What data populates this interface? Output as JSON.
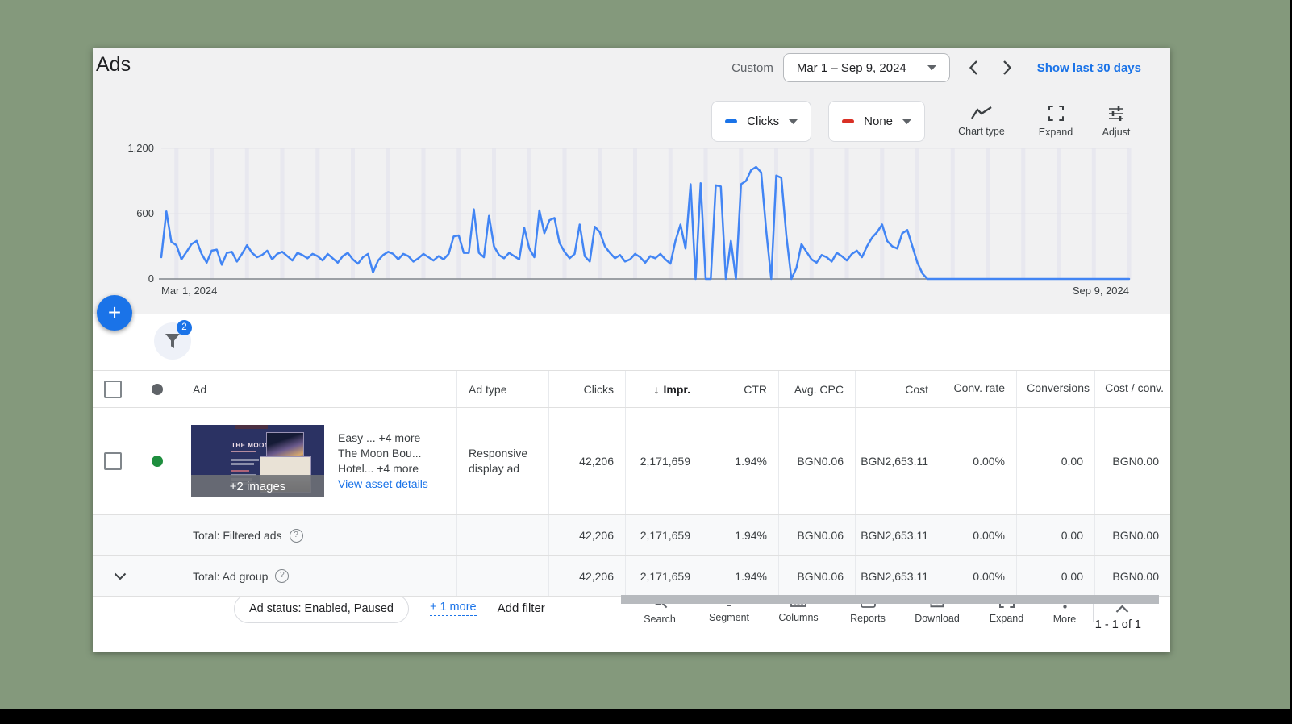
{
  "page": {
    "title": "Ads"
  },
  "date_bar": {
    "mode": "Custom",
    "range": "Mar 1 – Sep 9, 2024",
    "show_last": "Show last 30 days"
  },
  "chart_controls": {
    "metric_primary": {
      "label": "Clicks",
      "color": "#1a73e8"
    },
    "metric_secondary": {
      "label": "None",
      "color": "#d93025"
    },
    "chart_type": "Chart type",
    "expand": "Expand",
    "adjust": "Adjust"
  },
  "chart_data": {
    "type": "line",
    "title": "Clicks by day",
    "x_start": "2024-03-01",
    "x_end": "2024-09-09",
    "x_tick_labels": [
      "Mar 1, 2024",
      "Sep 9, 2024"
    ],
    "y_ticks": [
      0,
      600,
      1200
    ],
    "y_tick_labels": [
      "0",
      "600",
      "1,200"
    ],
    "ylim": [
      0,
      1300
    ],
    "grid": "weekly vertical bands, horizontal lines at 600 and 1200",
    "legend_position": "none",
    "series": [
      {
        "name": "Clicks",
        "color": "#4285f4",
        "values": [
          200,
          620,
          340,
          310,
          180,
          250,
          320,
          350,
          230,
          150,
          260,
          270,
          130,
          240,
          250,
          160,
          230,
          310,
          240,
          200,
          220,
          260,
          180,
          230,
          250,
          210,
          170,
          240,
          220,
          190,
          230,
          210,
          170,
          230,
          190,
          150,
          210,
          240,
          180,
          140,
          200,
          230,
          60,
          170,
          220,
          250,
          230,
          180,
          230,
          210,
          160,
          190,
          230,
          200,
          170,
          210,
          180,
          230,
          390,
          400,
          240,
          240,
          640,
          240,
          200,
          580,
          300,
          220,
          190,
          240,
          210,
          180,
          470,
          280,
          200,
          630,
          420,
          540,
          560,
          330,
          250,
          190,
          230,
          500,
          210,
          160,
          480,
          430,
          300,
          240,
          190,
          220,
          160,
          180,
          230,
          200,
          150,
          210,
          190,
          230,
          180,
          140,
          350,
          500,
          280,
          870,
          0,
          880,
          0,
          0,
          860,
          850,
          0,
          350,
          0,
          870,
          900,
          1000,
          1030,
          980,
          450,
          0,
          950,
          930,
          400,
          0,
          100,
          320,
          250,
          180,
          150,
          220,
          200,
          160,
          240,
          210,
          170,
          230,
          260,
          200,
          300,
          380,
          430,
          500,
          350,
          300,
          280,
          420,
          450,
          300,
          150,
          50,
          0,
          0,
          0,
          0,
          0,
          0,
          0,
          0,
          0,
          0,
          0,
          0,
          0,
          0,
          0,
          0,
          0,
          0,
          0,
          0,
          0,
          0,
          0,
          0,
          0,
          0,
          0,
          0,
          0,
          0,
          0,
          0,
          0,
          0,
          0,
          0,
          0,
          0,
          0,
          0,
          0
        ]
      }
    ]
  },
  "toolbar": {
    "fab_label": "+",
    "filter_badge": "2",
    "filter_chip": "Ad status: Enabled, Paused",
    "more_filters": "+ 1 more",
    "add_filter": "Add filter",
    "actions": [
      "Search",
      "Segment",
      "Columns",
      "Reports",
      "Download",
      "Expand",
      "More"
    ]
  },
  "table": {
    "headers": {
      "ad": "Ad",
      "ad_type": "Ad type",
      "clicks": "Clicks",
      "sort_arrow": "↓",
      "impressions": "Impr.",
      "ctr": "CTR",
      "avg_cpc": "Avg. CPC",
      "cost": "Cost",
      "conv_rate": "Conv. rate",
      "conversions": "Conversions",
      "cost_per_conv": "Cost / conv."
    },
    "ad_row": {
      "thumbnail": {
        "brand": "THE MOON",
        "overlay": "+2 images"
      },
      "name_lines": [
        "Easy ...  +4 more",
        "The Moon Bou...",
        "Hotel...  +4 more"
      ],
      "asset_link": "View asset details",
      "ad_type": "Responsive display ad",
      "clicks": "42,206",
      "impressions": "2,171,659",
      "ctr": "1.94%",
      "avg_cpc": "BGN0.06",
      "cost": "BGN2,653.11",
      "conv_rate": "0.00%",
      "conversions": "0.00",
      "cost_per_conv": "BGN0.00"
    },
    "totals": [
      {
        "label": "Total: Filtered ads",
        "clicks": "42,206",
        "impressions": "2,171,659",
        "ctr": "1.94%",
        "avg_cpc": "BGN0.06",
        "cost": "BGN2,653.11",
        "conv_rate": "0.00%",
        "conversions": "0.00",
        "cost_per_conv": "BGN0.00"
      },
      {
        "label": "Total: Ad group",
        "clicks": "42,206",
        "impressions": "2,171,659",
        "ctr": "1.94%",
        "avg_cpc": "BGN0.06",
        "cost": "BGN2,653.11",
        "conv_rate": "0.00%",
        "conversions": "0.00",
        "cost_per_conv": "BGN0.00"
      }
    ]
  },
  "pagination": {
    "label": "1 - 1 of 1"
  }
}
